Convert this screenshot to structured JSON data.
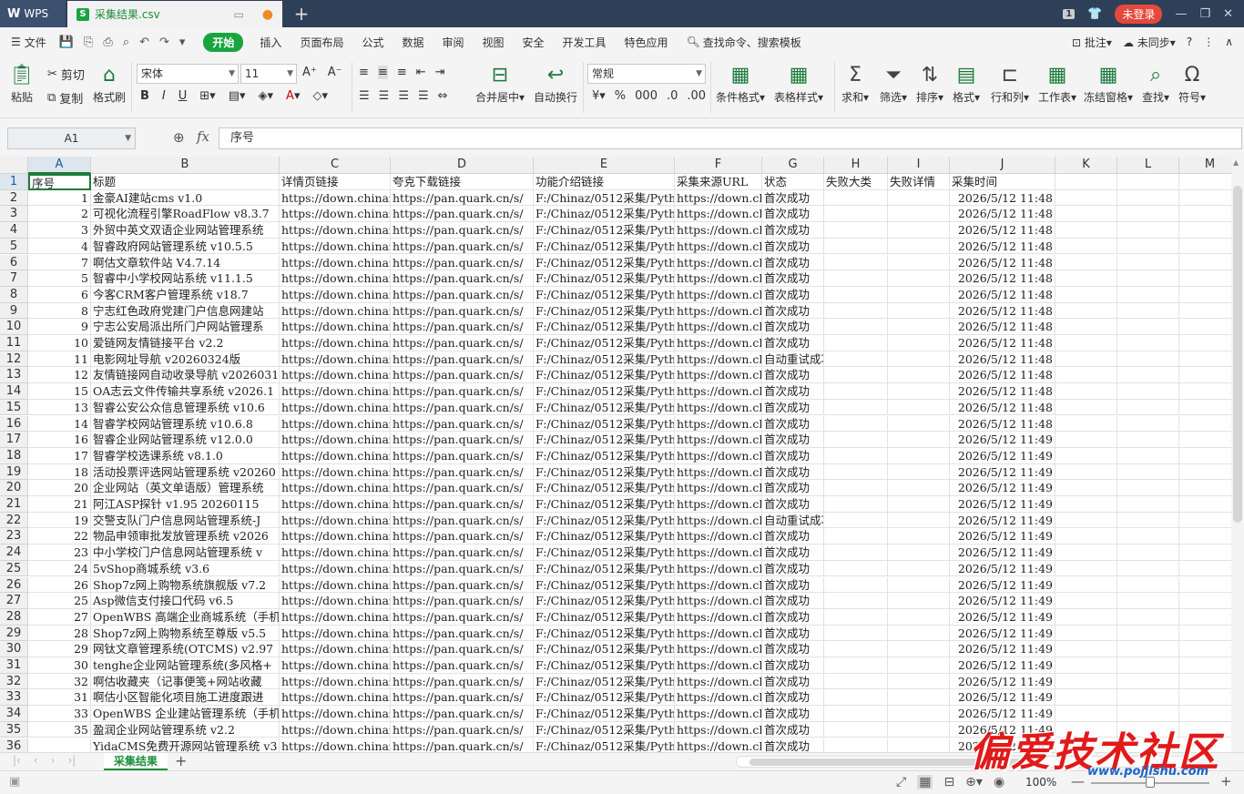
{
  "titlebar": {
    "app_label": "WPS",
    "doc_tab": "采集结果.csv",
    "notif_count": "1",
    "login_label": "未登录"
  },
  "menubar": {
    "file_label": "文件",
    "items": [
      "开始",
      "插入",
      "页面布局",
      "公式",
      "数据",
      "审阅",
      "视图",
      "安全",
      "开发工具",
      "特色应用"
    ],
    "active_index": 0,
    "search_label": "查找命令、搜索模板",
    "annotate_label": "批注",
    "sync_label": "未同步"
  },
  "ribbon": {
    "paste": "粘贴",
    "cut": "剪切",
    "copy": "复制",
    "format_painter": "格式刷",
    "font_name": "宋体",
    "font_size": "11",
    "merge_center": "合并居中",
    "wrap_text": "自动换行",
    "number_format": "常规",
    "cond_format": "条件格式",
    "table_style": "表格样式",
    "sum": "求和",
    "filter": "筛选",
    "sort": "排序",
    "format": "格式",
    "rows_cols": "行和列",
    "worksheet": "工作表",
    "freeze": "冻结窗格",
    "find": "查找",
    "symbol": "符号"
  },
  "formula_bar": {
    "name_box": "A1",
    "fx": "fx",
    "content": "序号"
  },
  "columns": [
    "A",
    "B",
    "C",
    "D",
    "E",
    "F",
    "G",
    "H",
    "I",
    "J",
    "K",
    "L",
    "M"
  ],
  "headers": [
    "序号",
    "标题",
    "详情页链接",
    "夸克下载链接",
    "功能介绍链接",
    "采集来源URL",
    "状态",
    "失败大类",
    "失败详情",
    "采集时间"
  ],
  "rows": [
    {
      "id": "1",
      "title": "金豪AI建站cms v1.0",
      "detail": "https://down.chinaz",
      "quark": "https://pan.quark.cn/s/",
      "intro": "F:/Chinaz/0512采集/Python",
      "src": "https://down.chinaz",
      "status": "首次成功",
      "time": "2026/5/12 11:48"
    },
    {
      "id": "2",
      "title": "可视化流程引擎RoadFlow v8.3.7",
      "detail": "https://down.chinaz",
      "quark": "https://pan.quark.cn/s/",
      "intro": "F:/Chinaz/0512采集/Python",
      "src": "https://down.chinaz",
      "status": "首次成功",
      "time": "2026/5/12 11:48"
    },
    {
      "id": "3",
      "title": "外贸中英文双语企业网站管理系统",
      "detail": "https://down.chinaz",
      "quark": "https://pan.quark.cn/s/",
      "intro": "F:/Chinaz/0512采集/Python",
      "src": "https://down.chinaz",
      "status": "首次成功",
      "time": "2026/5/12 11:48"
    },
    {
      "id": "4",
      "title": "智睿政府网站管理系统 v10.5.5",
      "detail": "https://down.chinaz",
      "quark": "https://pan.quark.cn/s/",
      "intro": "F:/Chinaz/0512采集/Python",
      "src": "https://down.chinaz",
      "status": "首次成功",
      "time": "2026/5/12 11:48"
    },
    {
      "id": "7",
      "title": "啊估文章软件站 V4.7.14",
      "detail": "https://down.chinaz",
      "quark": "https://pan.quark.cn/s/",
      "intro": "F:/Chinaz/0512采集/Python",
      "src": "https://down.chinaz",
      "status": "首次成功",
      "time": "2026/5/12 11:48"
    },
    {
      "id": "5",
      "title": "智睿中小学校网站系统 v11.1.5",
      "detail": "https://down.chinaz",
      "quark": "https://pan.quark.cn/s/",
      "intro": "F:/Chinaz/0512采集/Python",
      "src": "https://down.chinaz",
      "status": "首次成功",
      "time": "2026/5/12 11:48"
    },
    {
      "id": "6",
      "title": "今客CRM客户管理系统 v18.7",
      "detail": "https://down.chinaz",
      "quark": "https://pan.quark.cn/s/",
      "intro": "F:/Chinaz/0512采集/Python",
      "src": "https://down.chinaz",
      "status": "首次成功",
      "time": "2026/5/12 11:48"
    },
    {
      "id": "8",
      "title": "宁志红色政府党建门户信息网建站",
      "detail": "https://down.chinaz",
      "quark": "https://pan.quark.cn/s/",
      "intro": "F:/Chinaz/0512采集/Python",
      "src": "https://down.chinaz",
      "status": "首次成功",
      "time": "2026/5/12 11:48"
    },
    {
      "id": "9",
      "title": "宁志公安局派出所门户网站管理系",
      "detail": "https://down.chinaz",
      "quark": "https://pan.quark.cn/s/",
      "intro": "F:/Chinaz/0512采集/Python",
      "src": "https://down.chinaz",
      "status": "首次成功",
      "time": "2026/5/12 11:48"
    },
    {
      "id": "10",
      "title": "爱链网友情链接平台 v2.2",
      "detail": "https://down.chinaz",
      "quark": "https://pan.quark.cn/s/",
      "intro": "F:/Chinaz/0512采集/Python",
      "src": "https://down.chinaz",
      "status": "首次成功",
      "time": "2026/5/12 11:48"
    },
    {
      "id": "11",
      "title": "电影网址导航 v20260324版",
      "detail": "https://down.chinaz",
      "quark": "https://pan.quark.cn/s/",
      "intro": "F:/Chinaz/0512采集/Python",
      "src": "https://down.chinaz",
      "status": "自动重试成功",
      "time": "2026/5/12 11:48"
    },
    {
      "id": "12",
      "title": "友情链接网自动收录导航 v2026031",
      "detail": "https://down.chinaz",
      "quark": "https://pan.quark.cn/s/",
      "intro": "F:/Chinaz/0512采集/Python",
      "src": "https://down.chinaz",
      "status": "首次成功",
      "time": "2026/5/12 11:48"
    },
    {
      "id": "15",
      "title": "OA志云文件传输共享系统 v2026.1",
      "detail": "https://down.chinaz",
      "quark": "https://pan.quark.cn/s/",
      "intro": "F:/Chinaz/0512采集/Python",
      "src": "https://down.chinaz",
      "status": "首次成功",
      "time": "2026/5/12 11:48"
    },
    {
      "id": "13",
      "title": "智睿公安公众信息管理系统 v10.6",
      "detail": "https://down.chinaz",
      "quark": "https://pan.quark.cn/s/",
      "intro": "F:/Chinaz/0512采集/Python",
      "src": "https://down.chinaz",
      "status": "首次成功",
      "time": "2026/5/12 11:48"
    },
    {
      "id": "14",
      "title": "智睿学校网站管理系统 v10.6.8",
      "detail": "https://down.chinaz",
      "quark": "https://pan.quark.cn/s/",
      "intro": "F:/Chinaz/0512采集/Python",
      "src": "https://down.chinaz",
      "status": "首次成功",
      "time": "2026/5/12 11:48"
    },
    {
      "id": "16",
      "title": "智睿企业网站管理系统 v12.0.0",
      "detail": "https://down.chinaz",
      "quark": "https://pan.quark.cn/s/",
      "intro": "F:/Chinaz/0512采集/Python",
      "src": "https://down.chinaz",
      "status": "首次成功",
      "time": "2026/5/12 11:49"
    },
    {
      "id": "17",
      "title": "智睿学校选课系统 v8.1.0",
      "detail": "https://down.chinaz",
      "quark": "https://pan.quark.cn/s/",
      "intro": "F:/Chinaz/0512采集/Python",
      "src": "https://down.chinaz",
      "status": "首次成功",
      "time": "2026/5/12 11:49"
    },
    {
      "id": "18",
      "title": "活动投票评选网站管理系统 v20260",
      "detail": "https://down.chinaz",
      "quark": "https://pan.quark.cn/s/",
      "intro": "F:/Chinaz/0512采集/Python",
      "src": "https://down.chinaz",
      "status": "首次成功",
      "time": "2026/5/12 11:49"
    },
    {
      "id": "20",
      "title": "企业网站（英文单语版）管理系统",
      "detail": "https://down.chinaz",
      "quark": "https://pan.quark.cn/s/",
      "intro": "F:/Chinaz/0512采集/Python",
      "src": "https://down.chinaz",
      "status": "首次成功",
      "time": "2026/5/12 11:49"
    },
    {
      "id": "21",
      "title": "阿江ASP探针 v1.95 20260115",
      "detail": "https://down.chinaz",
      "quark": "https://pan.quark.cn/s/",
      "intro": "F:/Chinaz/0512采集/Python",
      "src": "https://down.chinaz",
      "status": "首次成功",
      "time": "2026/5/12 11:49"
    },
    {
      "id": "19",
      "title": "交警支队门户信息网站管理系统-J",
      "detail": "https://down.chinaz",
      "quark": "https://pan.quark.cn/s/",
      "intro": "F:/Chinaz/0512采集/Python",
      "src": "https://down.chinaz",
      "status": "自动重试成功",
      "time": "2026/5/12 11:49"
    },
    {
      "id": "22",
      "title": "物品申领审批发放管理系统 v2026",
      "detail": "https://down.chinaz",
      "quark": "https://pan.quark.cn/s/",
      "intro": "F:/Chinaz/0512采集/Python",
      "src": "https://down.chinaz",
      "status": "首次成功",
      "time": "2026/5/12 11:49"
    },
    {
      "id": "23",
      "title": "中小学校门户信息网站管理系统 v",
      "detail": "https://down.chinaz",
      "quark": "https://pan.quark.cn/s/",
      "intro": "F:/Chinaz/0512采集/Python",
      "src": "https://down.chinaz",
      "status": "首次成功",
      "time": "2026/5/12 11:49"
    },
    {
      "id": "24",
      "title": "5vShop商城系统 v3.6",
      "detail": "https://down.chinaz",
      "quark": "https://pan.quark.cn/s/",
      "intro": "F:/Chinaz/0512采集/Python",
      "src": "https://down.chinaz",
      "status": "首次成功",
      "time": "2026/5/12 11:49"
    },
    {
      "id": "26",
      "title": "Shop7z网上购物系统旗舰版 v7.2",
      "detail": "https://down.chinaz",
      "quark": "https://pan.quark.cn/s/",
      "intro": "F:/Chinaz/0512采集/Python",
      "src": "https://down.chinaz",
      "status": "首次成功",
      "time": "2026/5/12 11:49"
    },
    {
      "id": "25",
      "title": "Asp微信支付接口代码 v6.5",
      "detail": "https://down.chinaz",
      "quark": "https://pan.quark.cn/s/",
      "intro": "F:/Chinaz/0512采集/Python",
      "src": "https://down.chinaz",
      "status": "首次成功",
      "time": "2026/5/12 11:49"
    },
    {
      "id": "27",
      "title": "OpenWBS 高端企业商城系统（手机",
      "detail": "https://down.chinaz",
      "quark": "https://pan.quark.cn/s/",
      "intro": "F:/Chinaz/0512采集/Python",
      "src": "https://down.chinaz",
      "status": "首次成功",
      "time": "2026/5/12 11:49"
    },
    {
      "id": "28",
      "title": "Shop7z网上购物系统至尊版 v5.5",
      "detail": "https://down.chinaz",
      "quark": "https://pan.quark.cn/s/",
      "intro": "F:/Chinaz/0512采集/Python",
      "src": "https://down.chinaz",
      "status": "首次成功",
      "time": "2026/5/12 11:49"
    },
    {
      "id": "29",
      "title": "网钛文章管理系统(OTCMS) v2.97",
      "detail": "https://down.chinaz",
      "quark": "https://pan.quark.cn/s/",
      "intro": "F:/Chinaz/0512采集/Python",
      "src": "https://down.chinaz",
      "status": "首次成功",
      "time": "2026/5/12 11:49"
    },
    {
      "id": "30",
      "title": "tenghe企业网站管理系统(多风格+",
      "detail": "https://down.chinaz",
      "quark": "https://pan.quark.cn/s/",
      "intro": "F:/Chinaz/0512采集/Python",
      "src": "https://down.chinaz",
      "status": "首次成功",
      "time": "2026/5/12 11:49"
    },
    {
      "id": "32",
      "title": "啊估收藏夹（记事便笺+网站收藏",
      "detail": "https://down.chinaz",
      "quark": "https://pan.quark.cn/s/",
      "intro": "F:/Chinaz/0512采集/Python",
      "src": "https://down.chinaz",
      "status": "首次成功",
      "time": "2026/5/12 11:49"
    },
    {
      "id": "31",
      "title": "啊估小区智能化项目施工进度跟进",
      "detail": "https://down.chinaz",
      "quark": "https://pan.quark.cn/s/",
      "intro": "F:/Chinaz/0512采集/Python",
      "src": "https://down.chinaz",
      "status": "首次成功",
      "time": "2026/5/12 11:49"
    },
    {
      "id": "33",
      "title": "OpenWBS 企业建站管理系统（手机",
      "detail": "https://down.chinaz",
      "quark": "https://pan.quark.cn/s/",
      "intro": "F:/Chinaz/0512采集/Python",
      "src": "https://down.chinaz",
      "status": "首次成功",
      "time": "2026/5/12 11:49"
    },
    {
      "id": "35",
      "title": "盈润企业网站管理系统 v2.2",
      "detail": "https://down.chinaz",
      "quark": "https://pan.quark.cn/s/",
      "intro": "F:/Chinaz/0512采集/Python",
      "src": "https://down.chinaz",
      "status": "首次成功",
      "time": "2026/5/12 11:49"
    },
    {
      "id": "",
      "title": "YidaCMS免费开源网站管理系统 v3",
      "detail": "https://down.chinaz",
      "quark": "https://pan.quark.cn/s/",
      "intro": "F:/Chinaz/0512采集/Python",
      "src": "https://down.chinaz",
      "status": "首次成功",
      "time": "2026/5/12 11:49"
    }
  ],
  "sheet_tab": "采集结果",
  "status": {
    "zoom": "100%"
  },
  "watermark": {
    "main": "偏爱技术社区",
    "url": "www.pojjishu.com"
  },
  "colors": {
    "accent_green": "#18a53f",
    "titlebar": "#2e3f58",
    "login_red": "#e5483c"
  }
}
